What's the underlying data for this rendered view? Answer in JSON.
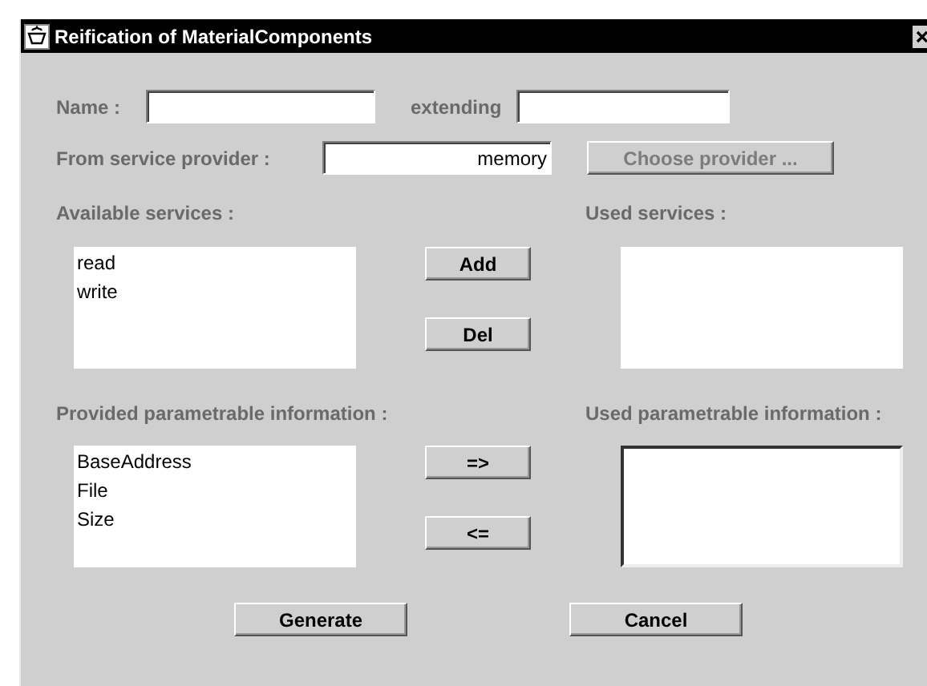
{
  "window": {
    "title": "Reification of MaterialComponents"
  },
  "name": {
    "label": "Name :"
  },
  "extending": {
    "label": "extending"
  },
  "provider": {
    "label": "From service provider :",
    "value": "memory"
  },
  "choose_button": {
    "label": "Choose provider ...",
    "disabled": true
  },
  "available_services": {
    "label": "Available services :",
    "items": [
      "read",
      "write"
    ]
  },
  "used_services": {
    "label": "Used services :"
  },
  "service_buttons": [
    "Add",
    "Del"
  ],
  "provided_info": {
    "label": "Provided parametrable information :",
    "items": [
      "BaseAddress",
      "File",
      "Size"
    ]
  },
  "used_info": {
    "label": "Used parametrable information :"
  },
  "info_buttons": [
    "=>",
    "<="
  ],
  "buttons": [
    "Generate",
    "Cancel"
  ]
}
